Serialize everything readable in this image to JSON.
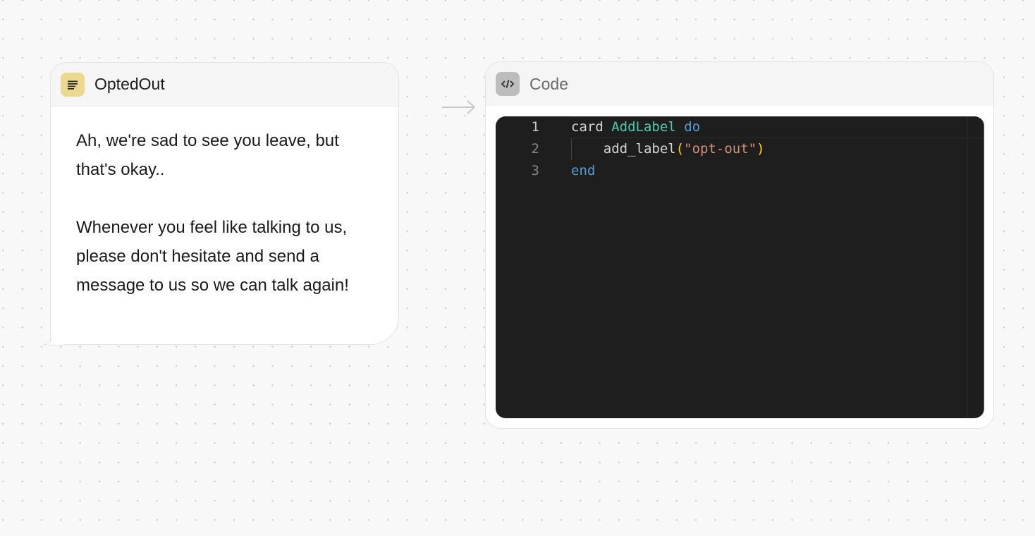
{
  "message_card": {
    "title": "OptedOut",
    "icon": "text-lines-icon",
    "icon_color": "#ead98f",
    "paragraphs": [
      "Ah, we're sad to see you leave, but that's okay..",
      "Whenever you feel like talking to us, please don't hesitate and send a message to us so we can talk again!"
    ]
  },
  "code_card": {
    "title": "Code",
    "icon": "code-brackets-icon",
    "icon_color": "#bdbdbd",
    "editor_background": "#1e1e1e",
    "lines": [
      {
        "number": "1",
        "tokens": [
          {
            "text": "card",
            "kind": "ident"
          },
          {
            "text": " ",
            "kind": "ident"
          },
          {
            "text": "AddLabel",
            "kind": "type"
          },
          {
            "text": " ",
            "kind": "ident"
          },
          {
            "text": "do",
            "kind": "kw"
          }
        ]
      },
      {
        "number": "2",
        "tokens": [
          {
            "text": "    add_label",
            "kind": "ident"
          },
          {
            "text": "(",
            "kind": "paren"
          },
          {
            "text": "\"opt-out\"",
            "kind": "str"
          },
          {
            "text": ")",
            "kind": "paren"
          }
        ]
      },
      {
        "number": "3",
        "tokens": [
          {
            "text": "end",
            "kind": "kw"
          }
        ]
      }
    ]
  },
  "colors": {
    "canvas_background": "#f8f8f8",
    "keyword": "#569cd6",
    "type_name": "#4ec9b0",
    "string": "#ce9178",
    "bracket": "#ffd700"
  }
}
